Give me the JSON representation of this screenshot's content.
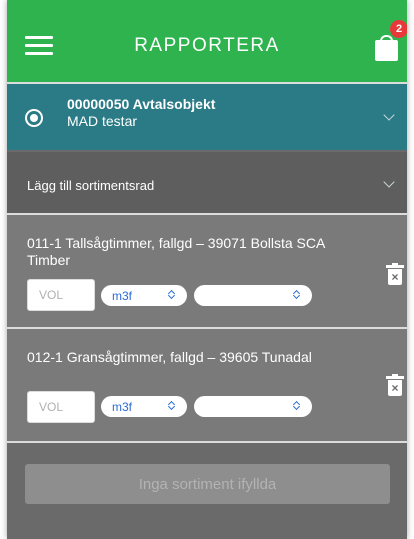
{
  "header": {
    "title": "RAPPORTERA",
    "menu_icon": "hamburger-menu-icon",
    "cart_icon": "shopping-bag-icon",
    "cart_badge": "2",
    "color": "#2fb34f"
  },
  "agreement": {
    "title": "00000050 Avtalsobjekt",
    "subtitle": "MAD testar",
    "selected": true,
    "color": "#2a7b86"
  },
  "add_row": {
    "label": "Lägg till sortimentsrad"
  },
  "products": [
    {
      "name": "011-1 Tallsågtimmer, fallgd – 39071 Bollsta SCA Timber",
      "volume_placeholder": "VOL",
      "volume_value": "",
      "unit": "m3f",
      "second_select": ""
    },
    {
      "name": "012-1 Gransågtimmer, fallgd – 39605 Tunadal",
      "volume_placeholder": "VOL",
      "volume_value": "",
      "unit": "m3f",
      "second_select": ""
    }
  ],
  "footer": {
    "button_label": "Inga sortiment ifyllda",
    "enabled": false
  },
  "colors": {
    "accent_blue": "#2c6cd6",
    "badge_red": "#e8393a"
  }
}
